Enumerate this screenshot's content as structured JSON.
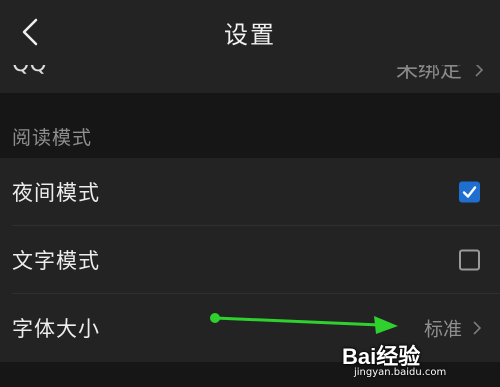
{
  "header": {
    "title": "设置"
  },
  "qq": {
    "label": "QQ",
    "value": "未绑定"
  },
  "reading": {
    "section_title": "阅读模式",
    "night_mode": {
      "label": "夜间模式",
      "checked": true
    },
    "text_mode": {
      "label": "文字模式",
      "checked": false
    },
    "font_size": {
      "label": "字体大小",
      "value": "标准"
    }
  },
  "colors": {
    "accent": "#1f6fd0",
    "annotation_arrow": "#2ed12e"
  },
  "watermark": {
    "logo": "Bai经验",
    "url": "jingyan.baidu.com"
  }
}
